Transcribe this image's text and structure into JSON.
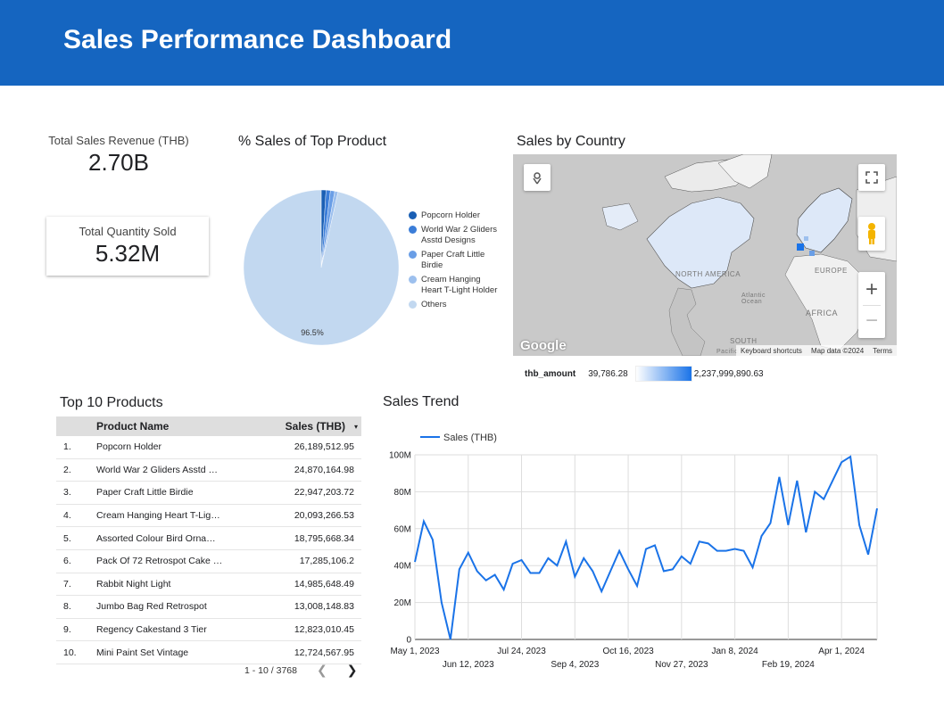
{
  "header": {
    "title": "Sales Performance Dashboard"
  },
  "kpis": {
    "revenue_label": "Total Sales Revenue (THB)",
    "revenue_value": "2.70B",
    "quantity_label": "Total Quantity Sold",
    "quantity_value": "5.32M"
  },
  "pie_section": {
    "title": "% Sales of Top Product",
    "slice_label": "96.5%"
  },
  "map_section": {
    "title": "Sales by Country",
    "footer_shortcuts": "Keyboard shortcuts",
    "footer_data": "Map data ©2024",
    "footer_terms": "Terms",
    "logo": "Google",
    "labels": {
      "north_america": "NORTH AMERICA",
      "africa": "AFRICA",
      "europe": "EUROPE",
      "south": "SOUTH",
      "atlantic": "Atlantic Ocean",
      "pacific": "Pacific"
    },
    "scale_metric": "thb_amount",
    "scale_min": "39,786.28",
    "scale_max": "2,237,999,890.63",
    "scale_colors": [
      "#ffffff",
      "#1a73e8"
    ]
  },
  "table_section": {
    "title": "Top 10 Products",
    "col_name": "Product Name",
    "col_sales": "Sales (THB)",
    "sort_icon": "▾",
    "rows": [
      {
        "idx": "1.",
        "name": "Popcorn Holder",
        "sales": "26,189,512.95"
      },
      {
        "idx": "2.",
        "name": "World War 2 Gliders Asstd …",
        "sales": "24,870,164.98"
      },
      {
        "idx": "3.",
        "name": "Paper Craft Little Birdie",
        "sales": "22,947,203.72"
      },
      {
        "idx": "4.",
        "name": "Cream Hanging Heart T-Lig…",
        "sales": "20,093,266.53"
      },
      {
        "idx": "5.",
        "name": "Assorted Colour Bird Orna…",
        "sales": "18,795,668.34"
      },
      {
        "idx": "6.",
        "name": "Pack Of 72 Retrospot Cake …",
        "sales": "17,285,106.2"
      },
      {
        "idx": "7.",
        "name": "Rabbit Night Light",
        "sales": "14,985,648.49"
      },
      {
        "idx": "8.",
        "name": "Jumbo Bag Red Retrospot",
        "sales": "13,008,148.83"
      },
      {
        "idx": "9.",
        "name": "Regency Cakestand 3 Tier",
        "sales": "12,823,010.45"
      },
      {
        "idx": "10.",
        "name": "Mini Paint Set Vintage",
        "sales": "12,724,567.95"
      }
    ],
    "pager_text": "1 - 10 / 3768"
  },
  "trend_section": {
    "title": "Sales Trend"
  },
  "chart_data": [
    {
      "type": "pie",
      "title": "% Sales of Top Product",
      "categories": [
        "Popcorn Holder",
        "World War 2 Gliders Asstd Designs",
        "Paper Craft Little Birdie",
        "Cream Hanging Heart T-Light Holder",
        "Others"
      ],
      "values": [
        1.0,
        0.9,
        0.9,
        0.7,
        96.5
      ],
      "colors": [
        "#1a5fb4",
        "#3b7dd8",
        "#6a9ee6",
        "#9dc0ee",
        "#c2d8f0"
      ],
      "legend": "right"
    },
    {
      "type": "line",
      "title": "Sales Trend",
      "series": [
        {
          "name": "Sales (THB)",
          "values": [
            42,
            64,
            54,
            20,
            0,
            38,
            47,
            37,
            32,
            35,
            27,
            41,
            43,
            36,
            36,
            44,
            40,
            53,
            34,
            44,
            37,
            26,
            37,
            48,
            38,
            29,
            49,
            51,
            37,
            38,
            45,
            41,
            53,
            52,
            48,
            48,
            49,
            48,
            39,
            56,
            63,
            88,
            62,
            86,
            58,
            80,
            76,
            86,
            96,
            99,
            62,
            46,
            71
          ]
        }
      ],
      "x_start": "May 1, 2023",
      "x_step_days": 7,
      "x_tick_labels": [
        "May 1, 2023",
        "Jun 12, 2023",
        "Jul 24, 2023",
        "Sep 4, 2023",
        "Oct 16, 2023",
        "Nov 27, 2023",
        "Jan 8, 2024",
        "Feb 19, 2024",
        "Apr 1, 2024"
      ],
      "y_tick_labels": [
        "0",
        "20M",
        "40M",
        "60M",
        "80M",
        "100M"
      ],
      "ylim": [
        0,
        100
      ],
      "y_unit": "M",
      "color": "#1a73e8",
      "grid": true,
      "legend": "top-left"
    }
  ]
}
